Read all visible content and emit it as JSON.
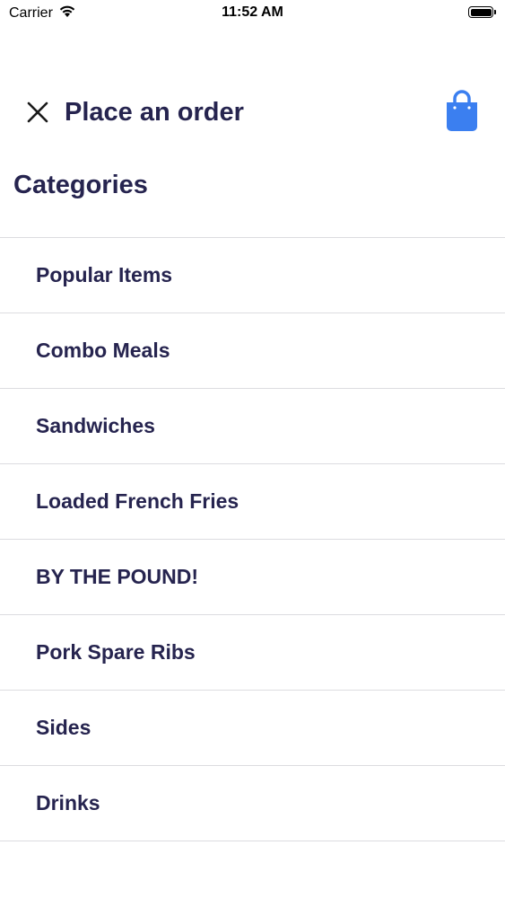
{
  "status_bar": {
    "carrier": "Carrier",
    "time": "11:52 AM",
    "battery_level": 1.0
  },
  "header": {
    "title": "Place an order",
    "close_icon": "close-icon",
    "cart_icon": "shopping-bag-icon",
    "accent_color": "#3b7ff0"
  },
  "section": {
    "title": "Categories"
  },
  "categories": [
    {
      "label": "Popular Items"
    },
    {
      "label": "Combo Meals"
    },
    {
      "label": "Sandwiches"
    },
    {
      "label": "Loaded French Fries"
    },
    {
      "label": "BY THE POUND!"
    },
    {
      "label": "Pork Spare Ribs"
    },
    {
      "label": "Sides"
    },
    {
      "label": "Drinks"
    }
  ],
  "colors": {
    "text": "#26244f",
    "divider": "#dcdce0",
    "background": "#ffffff"
  }
}
